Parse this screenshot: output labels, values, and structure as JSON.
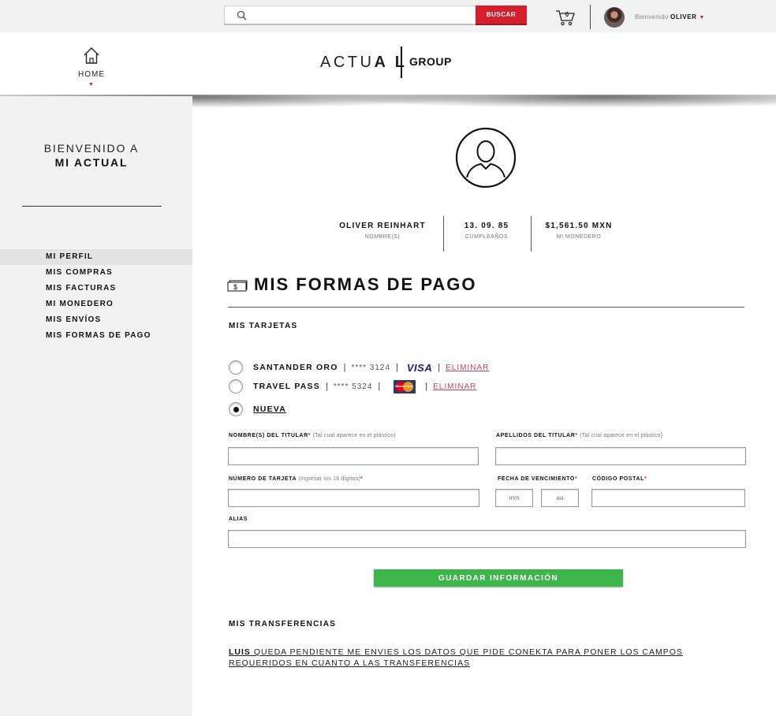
{
  "topbar": {
    "search_placeholder": "",
    "search_button": "BUSCAR",
    "cart_count": "0",
    "welcome_prefix": "Bienvenido",
    "user_name": "OLIVER"
  },
  "header": {
    "home_label": "HOME",
    "logo_actual_light": "ACTU",
    "logo_actual_bold": "A L",
    "logo_group": "GROUP"
  },
  "sidebar": {
    "welcome_line1": "BIENVENIDO A",
    "welcome_line2": "MI ACTUAL",
    "items": [
      {
        "label": "MI PERFIL"
      },
      {
        "label": "MIS COMPRAS"
      },
      {
        "label": "MIS FACTURAS"
      },
      {
        "label": "MI MONEDERO"
      },
      {
        "label": "MIS ENVÍOS"
      },
      {
        "label": "MIS FORMAS DE PAGO"
      }
    ]
  },
  "profile": {
    "name": "OLIVER REINHART",
    "name_label": "NOMBRE(S)",
    "birthday": "13. 09. 85",
    "birthday_label": "CUMPLEAÑOS",
    "wallet": "$1,561.50 MXN",
    "wallet_label": "MI MONEDERO"
  },
  "payment": {
    "title": "MIS FORMAS DE PAGO",
    "cards_heading": "MIS TARJETAS",
    "cards": [
      {
        "name": "SANTANDER ORO",
        "masked": "**** 3124",
        "brand": "VISA",
        "delete": "ELIMINAR"
      },
      {
        "name": "TRAVEL PASS",
        "masked": "**** 5324",
        "brand": "MasterCard",
        "delete": "ELIMINAR"
      }
    ],
    "new_label": "NUEVA",
    "form": {
      "holder_first_label": "NOMBRE(S) DEL TITULAR",
      "holder_first_hint": "(Tal cual aparece en el plástico)",
      "holder_last_label": "APELLIDOS DEL TITULAR",
      "holder_last_hint": "(Tal cual aparece en el plástico)",
      "card_number_label": "NÚMERO DE TARJETA",
      "card_number_hint": "(Ingresar los 16 dígitos)",
      "expiry_label": "FECHA DE VENCIMIENTO",
      "expiry_month_placeholder": "mm",
      "expiry_year_placeholder": "aa",
      "postal_label": "CÓDIGO POSTAL",
      "alias_label": "ALIAS",
      "required_mark": "*"
    },
    "save_button": "GUARDAR INFORMACIÓN",
    "transfers_heading": "MIS TRANSFERENCIAS",
    "note_bold": "LUIS",
    "note_text": " QUEDA PENDIENTE ME ENVIES LOS DATOS QUE PIDE CONEKTA PARA PONER LOS CAMPOS REQUERIDOS EN CUANTO A LAS TRANSFERENCIAS"
  },
  "colors": {
    "accent_red": "#d61f2c",
    "save_green": "#3db54a",
    "link_pink": "#d0425a",
    "sidebar_bg": "#f2f2f2"
  }
}
